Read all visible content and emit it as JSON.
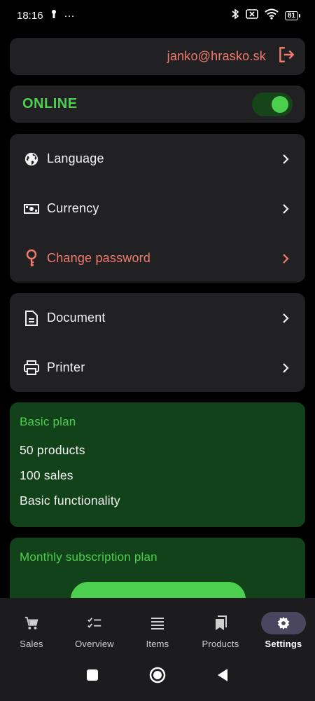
{
  "status_bar": {
    "time": "18:16",
    "dots": "···",
    "battery": "81"
  },
  "account": {
    "email": "janko@hrasko.sk"
  },
  "online": {
    "label": "ONLINE",
    "enabled": true
  },
  "settings_group_1": [
    {
      "label": "Language",
      "icon": "globe-icon"
    },
    {
      "label": "Currency",
      "icon": "banknote-icon"
    },
    {
      "label": "Change password",
      "icon": "key-icon",
      "color": "#f17b6d"
    }
  ],
  "settings_group_2": [
    {
      "label": "Document",
      "icon": "document-icon"
    },
    {
      "label": "Printer",
      "icon": "printer-icon"
    }
  ],
  "basic_plan": {
    "title": "Basic plan",
    "features": [
      "50 products",
      "100 sales",
      "Basic functionality"
    ]
  },
  "monthly_plan": {
    "title": "Monthly subscription plan"
  },
  "bottom_nav": {
    "tabs": [
      {
        "label": "Sales",
        "icon": "cart-icon"
      },
      {
        "label": "Overview",
        "icon": "checklist-icon"
      },
      {
        "label": "Items",
        "icon": "menu-icon"
      },
      {
        "label": "Products",
        "icon": "bookmarks-icon"
      },
      {
        "label": "Settings",
        "icon": "gear-icon",
        "active": true
      }
    ]
  },
  "colors": {
    "accent_green": "#4ccf4e",
    "danger": "#f17b6d",
    "card": "#212124",
    "plan_bg": "#12421a"
  }
}
